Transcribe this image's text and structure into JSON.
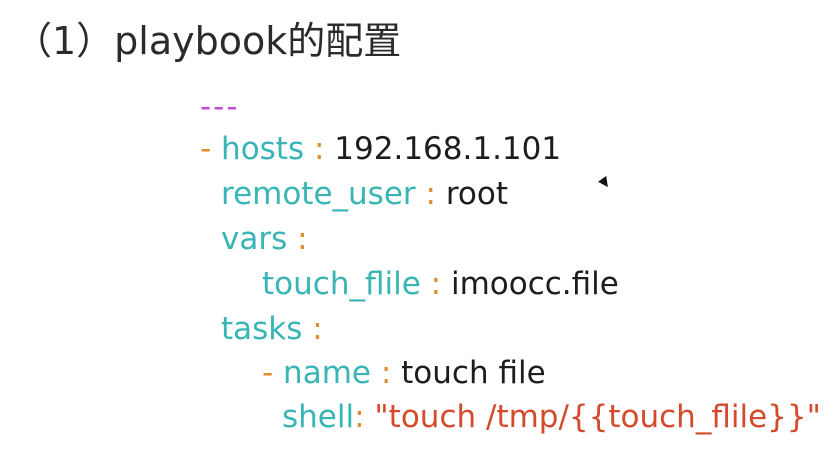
{
  "title": "（1）playbook的配置",
  "code": {
    "doc_start": "---",
    "line1": {
      "dash": "-",
      "key": "hosts",
      "colon": ":",
      "value": "192.168.1.101"
    },
    "line2": {
      "key": "remote_user",
      "colon": ":",
      "value": "root"
    },
    "line3": {
      "key": "vars",
      "colon": ":"
    },
    "line4": {
      "key": "touch_flile",
      "colon": ":",
      "value": "imoocc.file"
    },
    "line5": {
      "key": "tasks",
      "colon": ":"
    },
    "line6": {
      "dash": "-",
      "key": "name",
      "colon": ":",
      "value": "touch file"
    },
    "line7": {
      "key": "shell",
      "colon": ":",
      "value": "\"touch /tmp/{{touch_flile}}\""
    }
  },
  "colors": {
    "key": "#39b5b5",
    "punctuation": "#e08a2a",
    "value": "#1d1d1d",
    "string": "#d54a2c",
    "doc_start": "#c74ad6"
  }
}
